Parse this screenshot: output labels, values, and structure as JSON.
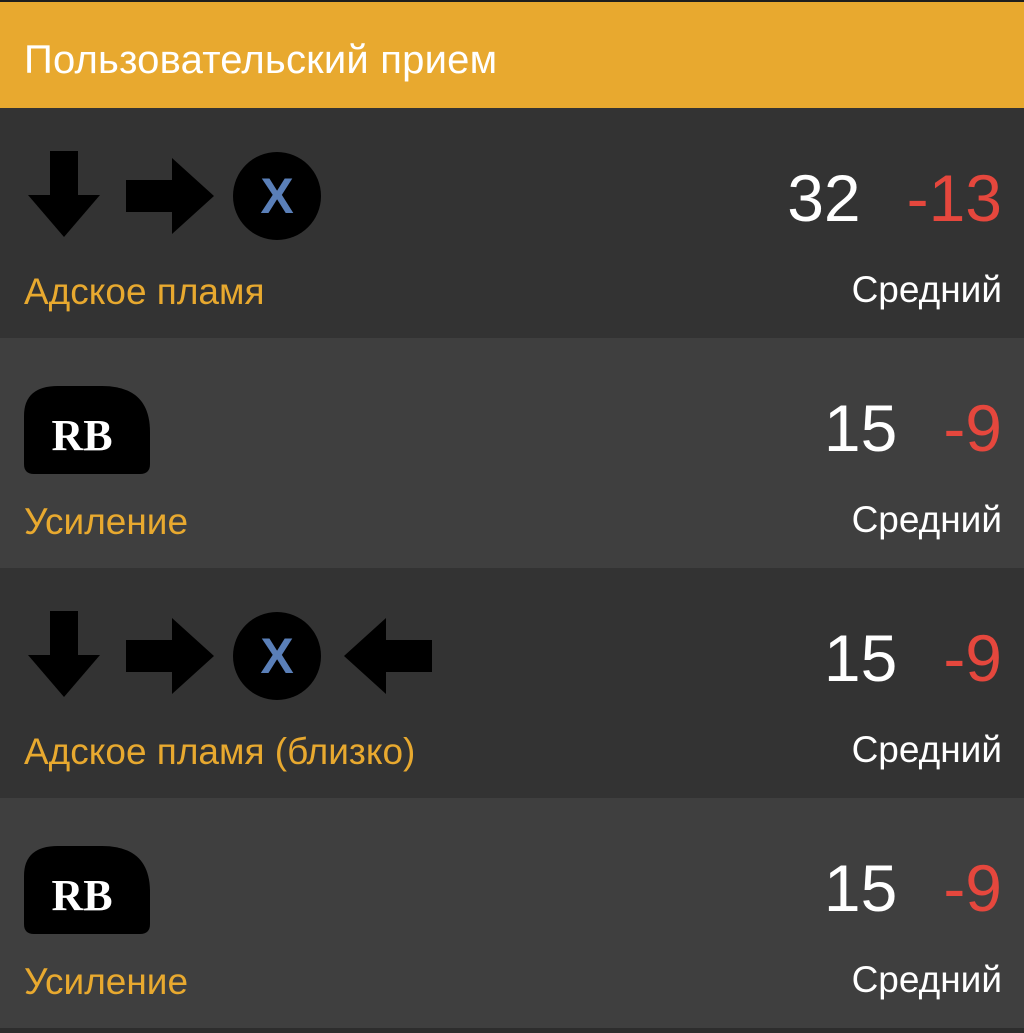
{
  "header": {
    "title": "Пользовательский прием"
  },
  "moves": [
    {
      "inputs": [
        "down-arrow-icon",
        "right-arrow-icon",
        "x-button-icon"
      ],
      "name": "Адское пламя",
      "startup": "32",
      "advantage": "-13",
      "hit_level": "Средний"
    },
    {
      "inputs": [
        "rb-button-icon"
      ],
      "name": "Усиление",
      "startup": "15",
      "advantage": "-9",
      "hit_level": "Средний"
    },
    {
      "inputs": [
        "down-arrow-icon",
        "right-arrow-icon",
        "x-button-icon",
        "left-arrow-icon"
      ],
      "name": "Адское пламя (близко)",
      "startup": "15",
      "advantage": "-9",
      "hit_level": "Средний"
    },
    {
      "inputs": [
        "rb-button-icon"
      ],
      "name": "Усиление",
      "startup": "15",
      "advantage": "-9",
      "hit_level": "Средний"
    }
  ],
  "buttons": {
    "x_label": "X",
    "rb_label": "RB"
  },
  "colors": {
    "accent": "#e8a92f",
    "row_dark": "#333333",
    "row_light": "#3f3f3f",
    "advantage_negative": "#e5473d",
    "x_button_letter": "#5a7fb8"
  }
}
